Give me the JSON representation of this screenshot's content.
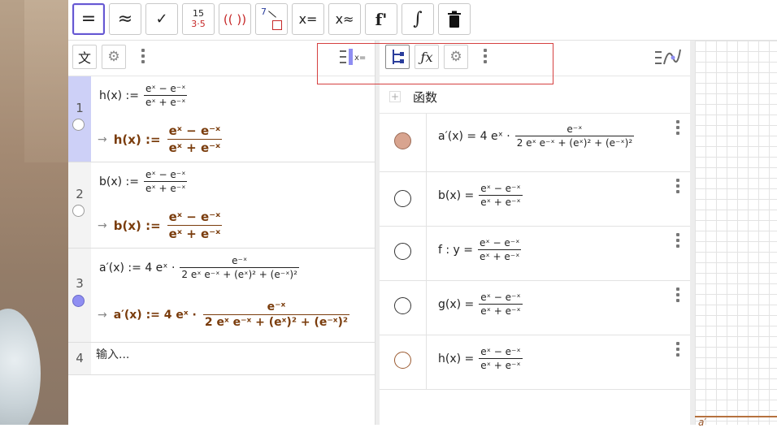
{
  "toolbar": {
    "buttons": [
      {
        "name": "evaluate-button",
        "label": "="
      },
      {
        "name": "numeric-button",
        "label": "≈"
      },
      {
        "name": "keep-input-button",
        "label": "✓"
      },
      {
        "name": "factor-button",
        "label_top": "15",
        "label_bottom": "3·5"
      },
      {
        "name": "expand-button",
        "label": "(( ))"
      },
      {
        "name": "substitute-button",
        "label": "7"
      },
      {
        "name": "solve-button",
        "label": "x="
      },
      {
        "name": "nsolve-button",
        "label": "x≈"
      },
      {
        "name": "derivative-button",
        "label": "f'"
      },
      {
        "name": "integral-button",
        "label": "∫"
      },
      {
        "name": "delete-button",
        "label": ""
      }
    ]
  },
  "algebra": {
    "lang_button": "文",
    "rows": [
      {
        "num": "1",
        "in_name": "h(x) :=",
        "in_num": "eˣ − e⁻ˣ",
        "in_den": "eˣ + e⁻ˣ",
        "out_name": "h(x)  :=",
        "out_num": "eˣ − e⁻ˣ",
        "out_den": "eˣ + e⁻ˣ"
      },
      {
        "num": "2",
        "in_name": "b(x) :=",
        "in_num": "eˣ − e⁻ˣ",
        "in_den": "eˣ + e⁻ˣ",
        "out_name": "b(x)  :=",
        "out_num": "eˣ − e⁻ˣ",
        "out_den": "eˣ + e⁻ˣ"
      },
      {
        "num": "3",
        "in_name": "a′(x) := 4 eˣ ·",
        "in_num": "e⁻ˣ",
        "in_den": "2 eˣ e⁻ˣ + (eˣ)² + (e⁻ˣ)²",
        "out_name": "a′(x)  :=  4 eˣ ·",
        "out_num": "e⁻ˣ",
        "out_den": "2 eˣ e⁻ˣ + (eˣ)² + (e⁻ˣ)²"
      }
    ],
    "input_row": {
      "num": "4",
      "placeholder": "输入..."
    }
  },
  "objects": {
    "header": "函数",
    "items": [
      {
        "name": "a′(x)  =  4 eˣ ·",
        "num": "e⁻ˣ",
        "den": "2 eˣ e⁻ˣ + (eˣ)² + (e⁻ˣ)²",
        "color": "#d8a48f"
      },
      {
        "name": "b(x)  =",
        "num": "eˣ − e⁻ˣ",
        "den": "eˣ + e⁻ˣ",
        "color": "#ffffff"
      },
      {
        "name": "f :  y  =",
        "num": "eˣ − e⁻ˣ",
        "den": "eˣ + e⁻ˣ",
        "color": "#ffffff"
      },
      {
        "name": "g(x)  =",
        "num": "eˣ − e⁻ˣ",
        "den": "eˣ + e⁻ˣ",
        "color": "#ffffff"
      },
      {
        "name": "h(x)  =",
        "num": "eˣ − e⁻ˣ",
        "den": "eˣ + e⁻ˣ",
        "color": "#ffffff"
      }
    ]
  },
  "graphics": {
    "label": "a′"
  },
  "colors": {
    "accent": "#6557d2",
    "output": "#7a3c0c",
    "selected_row": "#cdd0f7",
    "highlight_box": "#d54040"
  }
}
